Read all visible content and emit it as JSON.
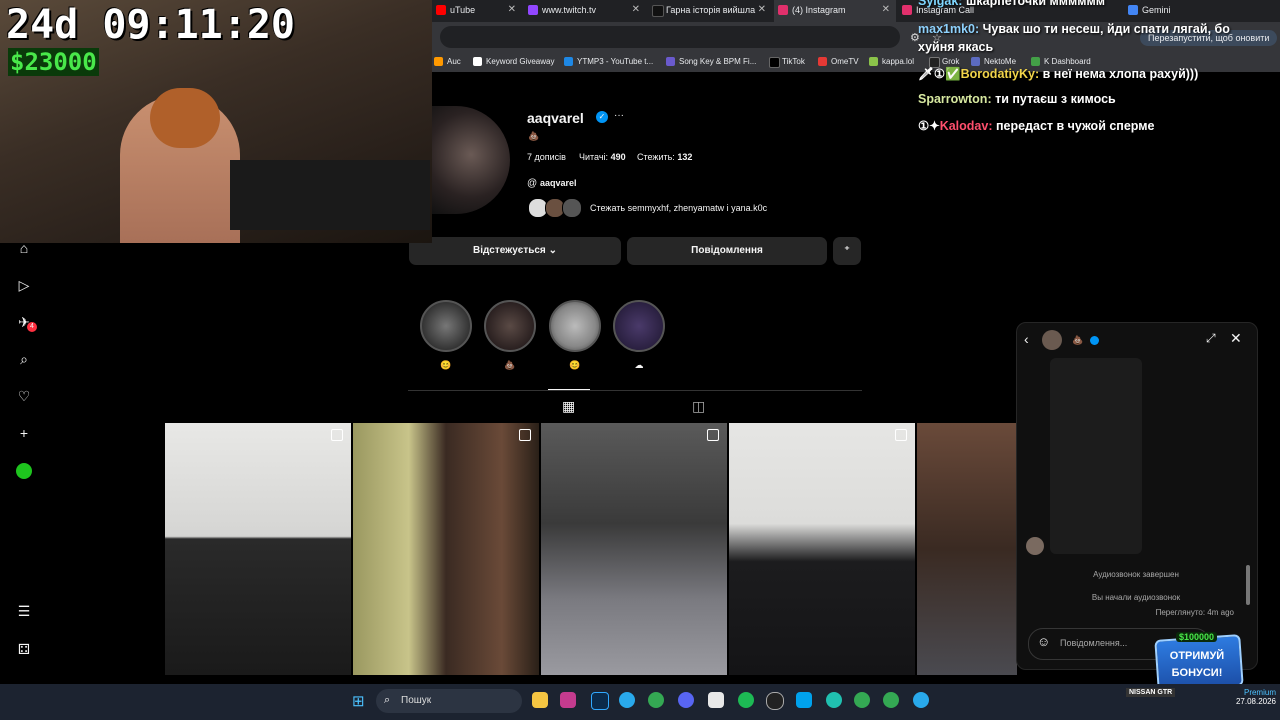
{
  "browser": {
    "tabs": [
      {
        "label": "uTube",
        "color": "#ff0000"
      },
      {
        "label": "www.twitch.tv",
        "color": "#9146ff"
      },
      {
        "label": "Гарна історія вийшла",
        "color": "#000000"
      },
      {
        "label": "(4) Instagram",
        "color": "#e1306c"
      },
      {
        "label": "Instagram Call",
        "color": "#e1306c"
      },
      {
        "label": "Gemini",
        "color": "#4285f4"
      }
    ],
    "restart_button": "Перезапустити, щоб оновити",
    "bookmarks": [
      {
        "label": "Auc",
        "color": "#ff9900"
      },
      {
        "label": "Keyword Giveaway",
        "color": "#ffffff"
      },
      {
        "label": "YTMP3 - YouTube t...",
        "color": "#1e88e5"
      },
      {
        "label": "Song Key & BPM Fi...",
        "color": "#6a5acd"
      },
      {
        "label": "TikTok",
        "color": "#000000"
      },
      {
        "label": "OmeTV",
        "color": "#e53935"
      },
      {
        "label": "kappa.lol",
        "color": "#8bc34a"
      },
      {
        "label": "Grok",
        "color": "#222222"
      },
      {
        "label": "NektoMe",
        "color": "#5c6bc0"
      },
      {
        "label": "K Dashboard",
        "color": "#43a047"
      }
    ]
  },
  "stream": {
    "timer": "24d 09:11:20",
    "money": "$23000"
  },
  "chat": [
    {
      "user": "Sylgak:",
      "text": "шкарпеточки мммммм",
      "color": "#ffffff"
    },
    {
      "user": "max1mk0:",
      "text": "Чувак шо ти несеш, йди спати лягай, бо хуйня якась",
      "color": "#8ed1fc"
    },
    {
      "user": "BorodatiyKy:",
      "text": "в неї нема хлопа рахуй)))",
      "color": "#f1d44a"
    },
    {
      "user": "Sparrowton:",
      "text": "ти путаєш з кимось",
      "color": "#d7e8a0"
    },
    {
      "user": "Kalodav:",
      "text": "передаст в чужой сперме",
      "color": "#ff4f6d"
    }
  ],
  "profile": {
    "username": "aaqvarel",
    "bio_icon": "poop-emoji",
    "posts": "7 дописів",
    "followers_label": "Читачі:",
    "followers": "490",
    "following_label": "Стежить:",
    "following": "132",
    "threads_handle": "aaqvarel",
    "followed_by": "Стежать semmyxhf, zhenyamatw і yana.k0c",
    "follow_button": "Відстежується",
    "message_button": "Повідомлення"
  },
  "highlights": [
    {
      "caption": "😊"
    },
    {
      "caption": "💩"
    },
    {
      "caption": "😊"
    },
    {
      "caption": "☁"
    }
  ],
  "dm": {
    "system_1": "Аудиозвонок завершен",
    "system_2": "Вы начали аудиозвонок",
    "seen": "Переглянуто: 4m ago",
    "input_placeholder": "Повідомлення..."
  },
  "bonus": {
    "amount": "$100000",
    "label_1": "ОТРИМУЙ",
    "label_2": "БОНУСИ!"
  },
  "taskbar": {
    "search_placeholder": "Пошук",
    "sponsor": "NISSAN GTR",
    "premium": "Premium",
    "date": "27.08.2026"
  }
}
